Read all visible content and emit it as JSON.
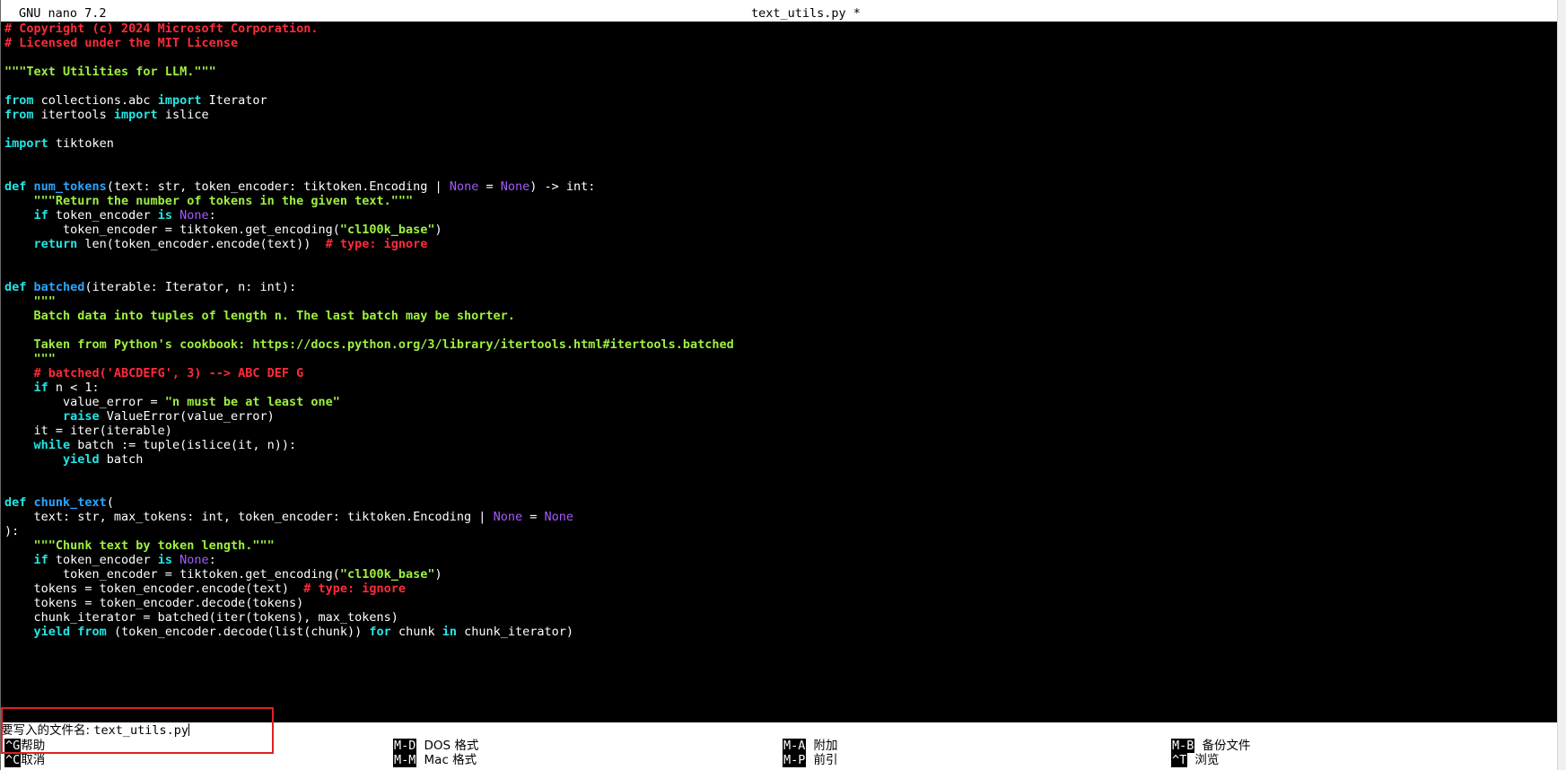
{
  "titlebar": {
    "app": "GNU nano 7.2",
    "filename": "text_utils.py *"
  },
  "colors": {
    "comment": "#ff2b3a",
    "string": "#9ef041",
    "keyword": "#23e6e6",
    "function": "#2aa4ff",
    "none_constant": "#a25cff",
    "annotation_box": "#e02020"
  },
  "code": {
    "l1": "# Copyright (c) 2024 Microsoft Corporation.",
    "l2": "# Licensed under the MIT License",
    "l4": "\"\"\"Text Utilities for LLM.\"\"\"",
    "l6a": "from",
    "l6b": " collections.abc ",
    "l6c": "import",
    "l6d": " Iterator",
    "l7a": "from",
    "l7b": " itertools ",
    "l7c": "import",
    "l7d": " islice",
    "l9a": "import",
    "l9b": " tiktoken",
    "l12a": "def",
    "l12b": " ",
    "l12c": "num_tokens",
    "l12d": "(text: str, token_encoder: tiktoken.Encoding | ",
    "l12e": "None",
    "l12f": " = ",
    "l12g": "None",
    "l12h": ") -> int:",
    "l13": "    \"\"\"Return the number of tokens in the given text.\"\"\"",
    "l14a": "    ",
    "l14b": "if",
    "l14c": " token_encoder ",
    "l14d": "is",
    "l14e": " ",
    "l14f": "None",
    "l14g": ":",
    "l15a": "        token_encoder = tiktoken.get_encoding(",
    "l15b": "\"cl100k_base\"",
    "l15c": ")",
    "l16a": "    ",
    "l16b": "return",
    "l16c": " len(token_encoder.encode(text))  ",
    "l16d": "# type: ignore",
    "l19a": "def",
    "l19b": " ",
    "l19c": "batched",
    "l19d": "(iterable: Iterator, n: int):",
    "l20": "    \"\"\"",
    "l21": "    Batch data into tuples of length n. The last batch may be shorter.",
    "l23": "    Taken from Python's cookbook: https://docs.python.org/3/library/itertools.html#itertools.batched",
    "l24": "    \"\"\"",
    "l25": "    # batched('ABCDEFG', 3) --> ABC DEF G",
    "l26a": "    ",
    "l26b": "if",
    "l26c": " n < 1:",
    "l27a": "        value_error = ",
    "l27b": "\"n must be at least one\"",
    "l28a": "        ",
    "l28b": "raise",
    "l28c": " ValueError(value_error)",
    "l29": "    it = iter(iterable)",
    "l30a": "    ",
    "l30b": "while",
    "l30c": " batch := tuple(islice(it, n)):",
    "l31a": "        ",
    "l31b": "yield",
    "l31c": " batch",
    "l34a": "def",
    "l34b": " ",
    "l34c": "chunk_text",
    "l34d": "(",
    "l35a": "    text: str, max_tokens: int, token_encoder: tiktoken.Encoding | ",
    "l35b": "None",
    "l35c": " = ",
    "l35d": "None",
    "l36": "):",
    "l37": "    \"\"\"Chunk text by token length.\"\"\"",
    "l38a": "    ",
    "l38b": "if",
    "l38c": " token_encoder ",
    "l38d": "is",
    "l38e": " ",
    "l38f": "None",
    "l38g": ":",
    "l39a": "        token_encoder = tiktoken.get_encoding(",
    "l39b": "\"cl100k_base\"",
    "l39c": ")",
    "l40a": "    tokens = token_encoder.encode(text)  ",
    "l40b": "# type: ignore",
    "l41": "    tokens = token_encoder.decode(tokens)",
    "l42": "    chunk_iterator = batched(iter(tokens), max_tokens)",
    "l43a": "    ",
    "l43b": "yield",
    "l43c": " ",
    "l43d": "from",
    "l43e": " (token_encoder.decode(list(chunk)) ",
    "l43f": "for",
    "l43g": " chunk ",
    "l43h": "in",
    "l43i": " chunk_iterator)"
  },
  "prompt": {
    "label": "要写入的文件名: ",
    "value": "text_utils.py"
  },
  "shortcuts": [
    {
      "key": "^G",
      "label": "帮助"
    },
    {
      "key": "^C",
      "label": "取消"
    },
    {
      "key": "M-D",
      "label": "DOS 格式"
    },
    {
      "key": "M-M",
      "label": "Mac 格式"
    },
    {
      "key": "M-A",
      "label": "附加"
    },
    {
      "key": "M-P",
      "label": "前引"
    },
    {
      "key": "M-B",
      "label": "备份文件"
    },
    {
      "key": "^T",
      "label": "浏览"
    }
  ]
}
